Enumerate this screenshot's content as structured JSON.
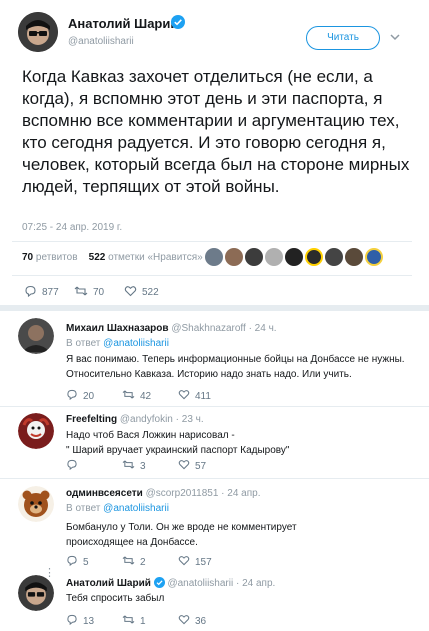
{
  "main": {
    "name": "Анатолий Шарий",
    "handle": "@anatoliisharii",
    "follow_label": "Читать",
    "text": "Когда Кавказ захочет отделиться (не если, а когда), я вспомню этот день и эти паспорта, я вспомню все комментарии и аргументацию тех, кто сегодня радуется. И это говорю сегодня я, человек, который всегда был на стороне мирных людей, терпящих от этой войны.",
    "time": "07:25 - 24 апр. 2019 г.",
    "retweets_count": "70",
    "retweets_label": "ретвитов",
    "likes_count": "522",
    "likes_label": "отметки «Нравится»",
    "reply_count": "877",
    "retweet_count": "70",
    "like_count": "522"
  },
  "replies": [
    {
      "name": "Михаил Шахназаров",
      "handle": "@Shakhnazaroff",
      "time": "· 24 ч.",
      "to_prefix": "В ответ",
      "to_handle": "@anatoliisharii",
      "text": "Я вас понимаю. Теперь информационные бойцы на Донбассе не нужны. Относительно Кавказа. Историю надо знать надо. Или учить.",
      "replies": "20",
      "retweets": "42",
      "likes": "411"
    },
    {
      "name": "Freefelting",
      "handle": "@andyfokin",
      "time": "· 23 ч.",
      "text": "Надо чтоб Вася Ложкин нарисовал   -\n\" Шарий вручает украинский паспорт Кадырову\"",
      "replies": "",
      "retweets": "3",
      "likes": "57"
    },
    {
      "name": "одминвсеясети",
      "handle": "@scorp2011851",
      "time": "· 24 апр.",
      "to_prefix": "В ответ",
      "to_handle": "@anatoliisharii",
      "text": "Бомбануло у Толи. Он же вроде не комментирует происходящее на Донбассе.",
      "replies": "5",
      "retweets": "2",
      "likes": "157"
    },
    {
      "name": "Анатолий Шарий",
      "handle": "@anatoliisharii",
      "time": "· 24 апр.",
      "text": "Тебя спросить забыл",
      "replies": "13",
      "retweets": "1",
      "likes": "36"
    }
  ],
  "colors": {
    "accent": "#1b95e0",
    "muted": "#8f9aa3",
    "verified": "#1da1f2"
  }
}
